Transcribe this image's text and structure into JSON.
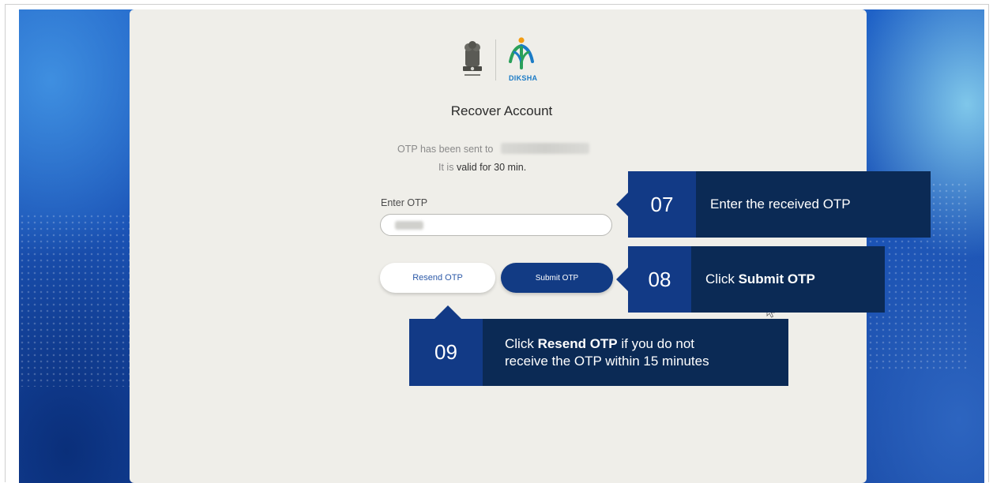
{
  "page": {
    "title": "Recover Account",
    "otp_sent_text": "OTP has been sent to",
    "validity_prefix": "It is",
    "validity_text": "valid for 30 min.",
    "otp_label": "Enter OTP",
    "resend_label": "Resend OTP",
    "submit_label": "Submit OTP",
    "logo_text": "DIKSHA"
  },
  "callouts": [
    {
      "num": "07",
      "text": "Enter the received OTP"
    },
    {
      "num": "08",
      "text_prefix": "Click ",
      "text_bold": "Submit OTP"
    },
    {
      "num": "09",
      "text_prefix": "Click ",
      "text_bold": "Resend OTP",
      "text_suffix": " if you do not",
      "text_line2": "receive the OTP within 15 minutes"
    }
  ],
  "colors": {
    "card_bg": "#efeee9",
    "callout_dark": "#0b2a55",
    "callout_num": "#123a86",
    "submit_btn": "#123b84",
    "background_blue": "#1c55b8"
  },
  "icons": [
    "emblem-icon",
    "diksha-logo-icon",
    "cursor-icon"
  ]
}
